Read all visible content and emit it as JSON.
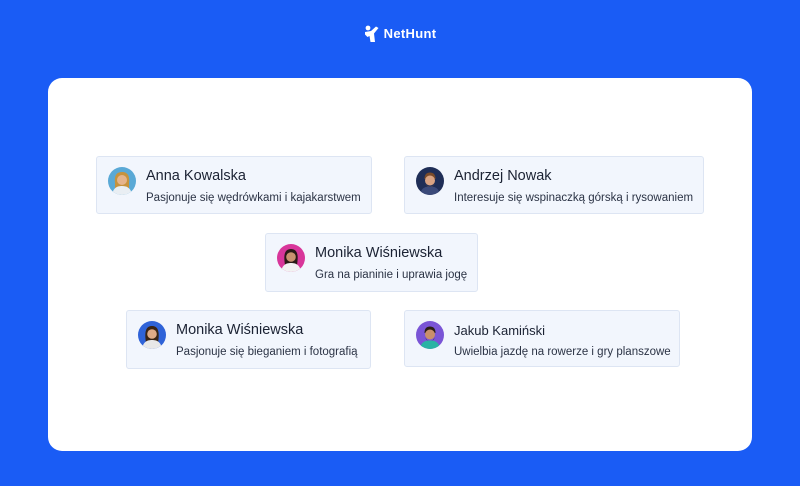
{
  "brand": {
    "name": "NetHunt",
    "color": "#ffffff",
    "background": "#1a5cf5"
  },
  "cards": [
    {
      "name": "Anna Kowalska",
      "description": "Pasjonuje się wędrówkami i kajakarstwem",
      "avatar_bg": "#5aa9d6",
      "avatar_hair": "#c7933d",
      "avatar_shirt": "#e9eef3"
    },
    {
      "name": "Andrzej Nowak",
      "description": "Interesuje się wspinaczką górską i rysowaniem",
      "avatar_bg": "#1f2e57",
      "avatar_hair": "#7a4b2a",
      "avatar_shirt": "#3b4a7a"
    },
    {
      "name": "Monika Wiśniewska",
      "description": "Gra na pianinie i uprawia jogę",
      "avatar_bg": "#d8369a",
      "avatar_hair": "#2a1b16",
      "avatar_shirt": "#f2f2f2"
    },
    {
      "name": "Monika Wiśniewska",
      "description": "Pasjonuje się bieganiem i fotografią",
      "avatar_bg": "#2f63d8",
      "avatar_hair": "#3a2414",
      "avatar_shirt": "#e8e8e8"
    },
    {
      "name": "Jakub Kamiński",
      "description": "Uwielbia jazdę na rowerze i gry planszowe",
      "avatar_bg": "#7a55d6",
      "avatar_hair": "#2a1e16",
      "avatar_shirt": "#2bb3a4"
    }
  ]
}
